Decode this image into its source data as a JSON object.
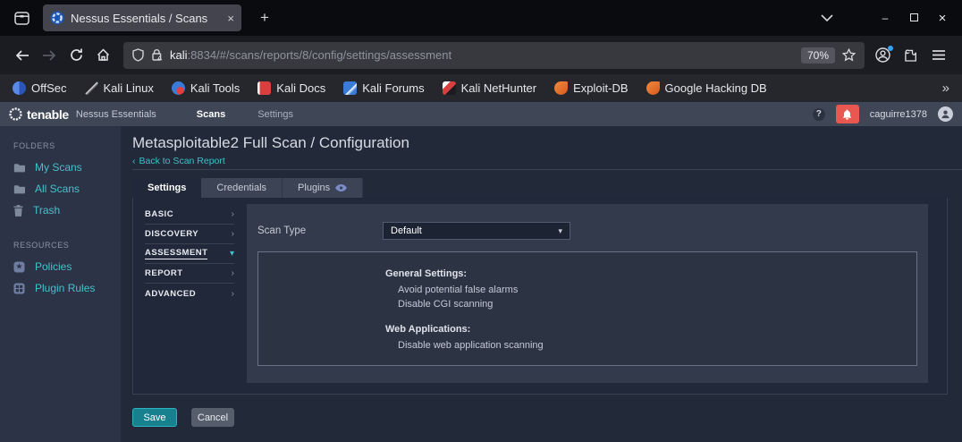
{
  "glyphs": {
    "close": "×",
    "plus": "+",
    "minimize": "–",
    "overflow": "»",
    "chevron_right": "›",
    "caret_down": "▾",
    "back_chevron": "‹",
    "question": "?"
  },
  "colors": {
    "accent_teal": "#3fc0ca",
    "save_button": "#17818f",
    "alert_red": "#e85850",
    "panel_bg": "#212839",
    "sidebar_bg": "#2c3346",
    "header_bg": "#3f4655"
  },
  "browser": {
    "tab": {
      "title": "Nessus Essentials / Scans"
    },
    "url": {
      "host": "kali",
      "rest": ":8834/#/scans/reports/8/config/settings/assessment"
    },
    "zoom_badge": "70%",
    "bookmarks": [
      {
        "label": "OffSec"
      },
      {
        "label": "Kali Linux"
      },
      {
        "label": "Kali Tools"
      },
      {
        "label": "Kali Docs"
      },
      {
        "label": "Kali Forums"
      },
      {
        "label": "Kali NetHunter"
      },
      {
        "label": "Exploit-DB"
      },
      {
        "label": "Google Hacking DB"
      }
    ]
  },
  "app_header": {
    "brand_bold": "tenable",
    "brand_product": "Nessus Essentials",
    "nav": [
      {
        "label": "Scans"
      },
      {
        "label": "Settings"
      }
    ],
    "username": "caguirre1378"
  },
  "sidebar": {
    "sections": [
      {
        "title": "FOLDERS",
        "items": [
          {
            "label": "My Scans"
          },
          {
            "label": "All Scans"
          },
          {
            "label": "Trash"
          }
        ]
      },
      {
        "title": "RESOURCES",
        "items": [
          {
            "label": "Policies"
          },
          {
            "label": "Plugin Rules"
          }
        ]
      }
    ]
  },
  "main": {
    "title": "Metasploitable2 Full Scan / Configuration",
    "back_link": "Back to Scan Report",
    "tabs": [
      {
        "label": "Settings"
      },
      {
        "label": "Credentials"
      },
      {
        "label": "Plugins"
      }
    ],
    "settings_nav": [
      "BASIC",
      "DISCOVERY",
      "ASSESSMENT",
      "REPORT",
      "ADVANCED"
    ],
    "form": {
      "scan_type_label": "Scan Type",
      "scan_type_value": "Default",
      "summary": [
        {
          "heading": "General Settings:",
          "items": [
            "Avoid potential false alarms",
            "Disable CGI scanning"
          ]
        },
        {
          "heading": "Web Applications:",
          "items": [
            "Disable web application scanning"
          ]
        }
      ]
    },
    "buttons": {
      "save": "Save",
      "cancel": "Cancel"
    }
  }
}
